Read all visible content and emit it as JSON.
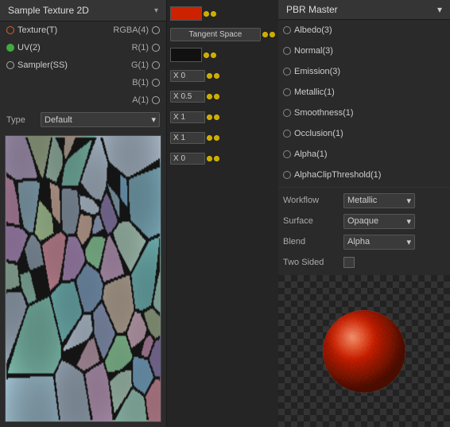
{
  "left_panel": {
    "header": {
      "title": "Sample Texture 2D",
      "arrow": "▾"
    },
    "nodes": [
      {
        "id": "texture",
        "label": "Texture(T)",
        "right_label": "RGBA(4)",
        "dot_left": "orange",
        "dot_right": "white"
      },
      {
        "id": "uv",
        "label": "UV(2)",
        "right_label": "R(1)",
        "dot_left": "green",
        "dot_right": "white"
      },
      {
        "id": "sampler",
        "label": "Sampler(SS)",
        "right_label": "G(1)",
        "dot_left": "white",
        "dot_right": "white"
      },
      {
        "id": "b",
        "label": "",
        "right_label": "B(1)",
        "dot_left": null,
        "dot_right": "white"
      },
      {
        "id": "a",
        "label": "",
        "right_label": "A(1)",
        "dot_left": null,
        "dot_right": "white"
      }
    ],
    "type_row": {
      "label": "Type",
      "value": "Default"
    }
  },
  "middle_panel": {
    "rows": [
      {
        "id": "albedo_swatch",
        "swatch": "red",
        "type": "swatch"
      },
      {
        "id": "tangent",
        "label": "Tangent Space",
        "type": "button"
      },
      {
        "id": "emission_swatch",
        "swatch": "black",
        "type": "swatch"
      },
      {
        "id": "metallic_x",
        "value": "X 0",
        "type": "input"
      },
      {
        "id": "smoothness_x",
        "value": "X 0.5",
        "type": "input"
      },
      {
        "id": "occlusion_x",
        "value": "X 1",
        "type": "input"
      },
      {
        "id": "alpha_x",
        "value": "X 1",
        "type": "input"
      },
      {
        "id": "alphaclip_x",
        "value": "X 0",
        "type": "input"
      }
    ]
  },
  "right_panel": {
    "header": {
      "title": "PBR Master",
      "arrow": "▾"
    },
    "sockets": [
      {
        "id": "albedo",
        "label": "Albedo(3)"
      },
      {
        "id": "normal",
        "label": "Normal(3)"
      },
      {
        "id": "emission",
        "label": "Emission(3)"
      },
      {
        "id": "metallic",
        "label": "Metallic(1)"
      },
      {
        "id": "smoothness",
        "label": "Smoothness(1)"
      },
      {
        "id": "occlusion",
        "label": "Occlusion(1)"
      },
      {
        "id": "alpha",
        "label": "Alpha(1)"
      },
      {
        "id": "alphaclipthreshold",
        "label": "AlphaClipThreshold(1)"
      }
    ],
    "properties": {
      "workflow": {
        "label": "Workflow",
        "value": "Metallic"
      },
      "surface": {
        "label": "Surface",
        "value": "Opaque"
      },
      "blend": {
        "label": "Blend",
        "value": "Alpha"
      },
      "two_sided": {
        "label": "Two Sided"
      }
    }
  }
}
